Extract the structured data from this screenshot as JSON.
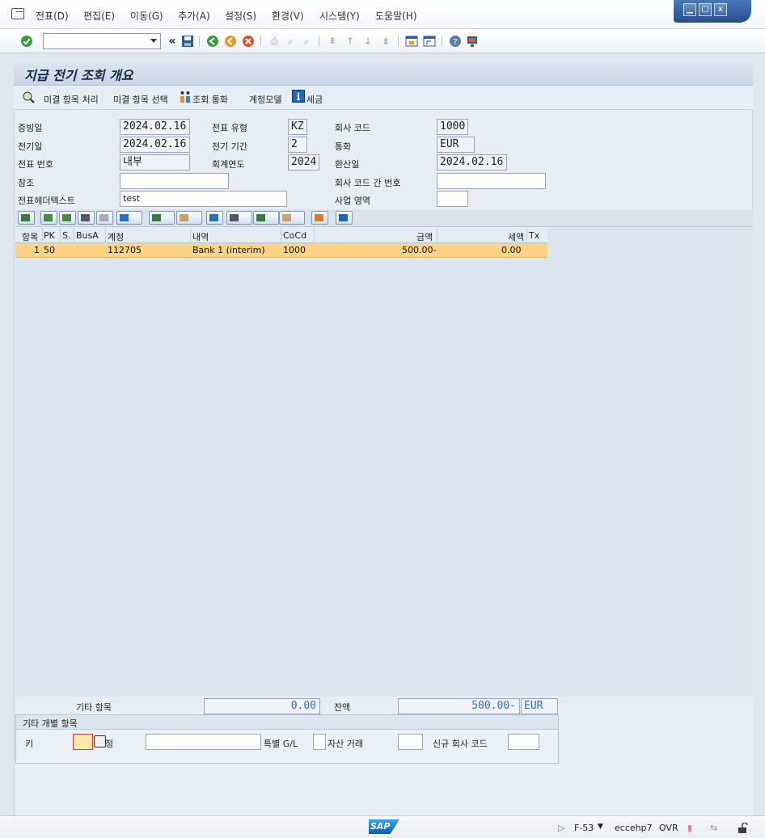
{
  "menubar": {
    "items": [
      "전표(D)",
      "편집(E)",
      "이동(G)",
      "추가(A)",
      "설정(S)",
      "환경(V)",
      "시스템(Y)",
      "도움말(H)"
    ]
  },
  "window_controls": {
    "minimize": "▁",
    "maximize": "□",
    "close": "x"
  },
  "toolbar": {
    "command_value": "",
    "nav_back": "«"
  },
  "screen": {
    "title": "지급 전기 조회 개요"
  },
  "app_toolbar": {
    "open_items": "미결 항목 처리",
    "select_open_items": "미결 항목 선택",
    "display_currency": "조회 통화",
    "account_model": "계정모델",
    "tax": "세금"
  },
  "header": {
    "doc_date_label": "증빙일",
    "doc_date": "2024.02.16",
    "posting_date_label": "전기일",
    "posting_date": "2024.02.16",
    "doc_number_label": "전표 번호",
    "doc_number": "내부",
    "reference_label": "참조",
    "reference": "",
    "header_text_label": "전표헤더텍스트",
    "header_text": "test",
    "doc_type_label": "전표 유형",
    "doc_type": "KZ",
    "period_label": "전기 기간",
    "period": "2",
    "fiscal_year_label": "회계연도",
    "fiscal_year": "2024",
    "company_code_label": "회사 코드",
    "company_code": "1000",
    "currency_label": "통화",
    "currency": "EUR",
    "translation_date_label": "환산일",
    "translation_date": "2024.02.16",
    "intercompany_label": "회사 코드 간 번호",
    "intercompany": "",
    "business_area_label": "사업 영역",
    "business_area": ""
  },
  "grid": {
    "columns": [
      "항목",
      "PK",
      "S.",
      "BusA",
      "계정",
      "내역",
      "CoCd",
      "금액",
      "세액",
      "Tx"
    ],
    "rows": [
      {
        "item": "1",
        "pk": "50",
        "s": "",
        "busa": "",
        "account": "112705",
        "desc": "Bank 1 (interim)",
        "cocd": "1000",
        "amount": "500.00-",
        "tax": "0.00",
        "tx": ""
      }
    ]
  },
  "totals": {
    "other_items_label": "기타 항목",
    "other_items": "0.00",
    "balance_label": "잔액",
    "balance": "500.00-",
    "balance_currency": "EUR"
  },
  "other_line_items": {
    "group_title": "기타 개별 항목",
    "key_label": "키",
    "key_value": "",
    "account_suffix": "정",
    "account_value": "",
    "special_gl_label": "특별 G/L",
    "special_gl": "",
    "asset_txn_label": "자산 거래",
    "asset_txn": "",
    "new_company_label": "신규 회사 코드",
    "new_company": ""
  },
  "statusbar": {
    "logo": "SAP",
    "transaction": "F-53",
    "server": "eccehp7",
    "mode": "OVR"
  }
}
